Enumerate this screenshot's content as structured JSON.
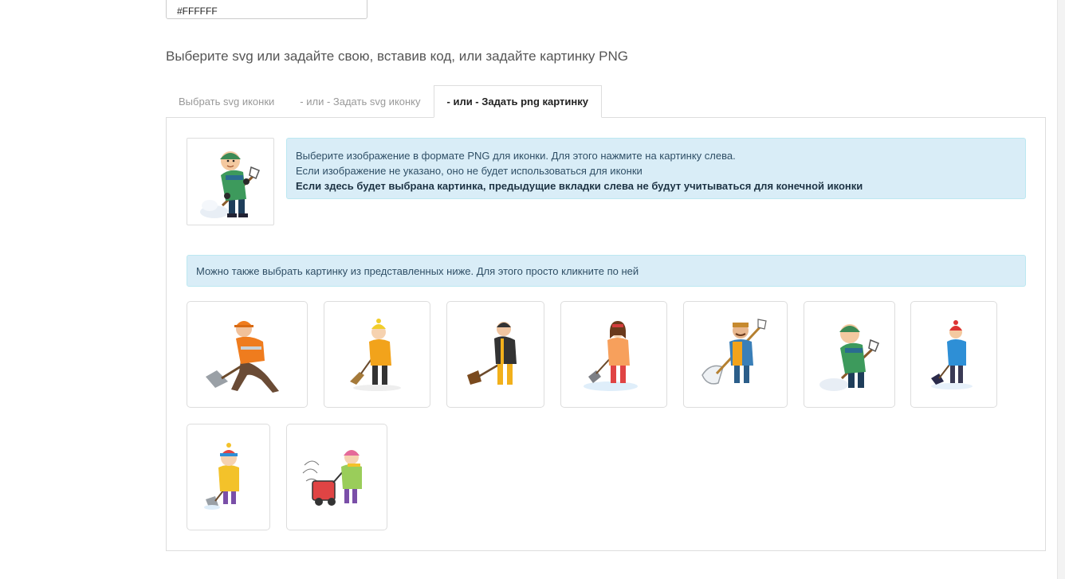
{
  "color_field": {
    "value": "#FFFFFF"
  },
  "section": {
    "title": "Выберите svg или задайте свою, вставив код, или задайте картинку PNG"
  },
  "tabs": [
    {
      "label": "Выбрать svg иконки"
    },
    {
      "label": "- или - Задать svg иконку"
    },
    {
      "label": "- или - Задать png картинку"
    }
  ],
  "info": {
    "line1": "Выберите изображение в формате PNG для иконки. Для этого нажмите на картинку слева.",
    "line2": "Если изображение не указано, оно не будет использоваться для иконки",
    "line3": "Если здесь будет выбрана картинка, предыдущие вкладки слева не будут учитываться для конечной иконки"
  },
  "gallery_hint": "Можно также выбрать картинку из представленных ниже. Для этого просто кликните по ней",
  "colors": {
    "alert_bg": "#d9edf7",
    "alert_border": "#bce8f1",
    "border": "#dddddd"
  },
  "images": [
    {
      "name": "shoveler-orange-vest-icon"
    },
    {
      "name": "sweeper-yellow-jacket-icon"
    },
    {
      "name": "shoveler-black-yellow-icon"
    },
    {
      "name": "girl-shoveling-snow-icon"
    },
    {
      "name": "mustached-man-shovel-icon"
    },
    {
      "name": "green-jacket-shoveler-icon"
    },
    {
      "name": "boy-blue-jacket-shovel-icon"
    },
    {
      "name": "child-yellow-coat-shovel-icon"
    },
    {
      "name": "snowblower-kid-icon"
    }
  ]
}
